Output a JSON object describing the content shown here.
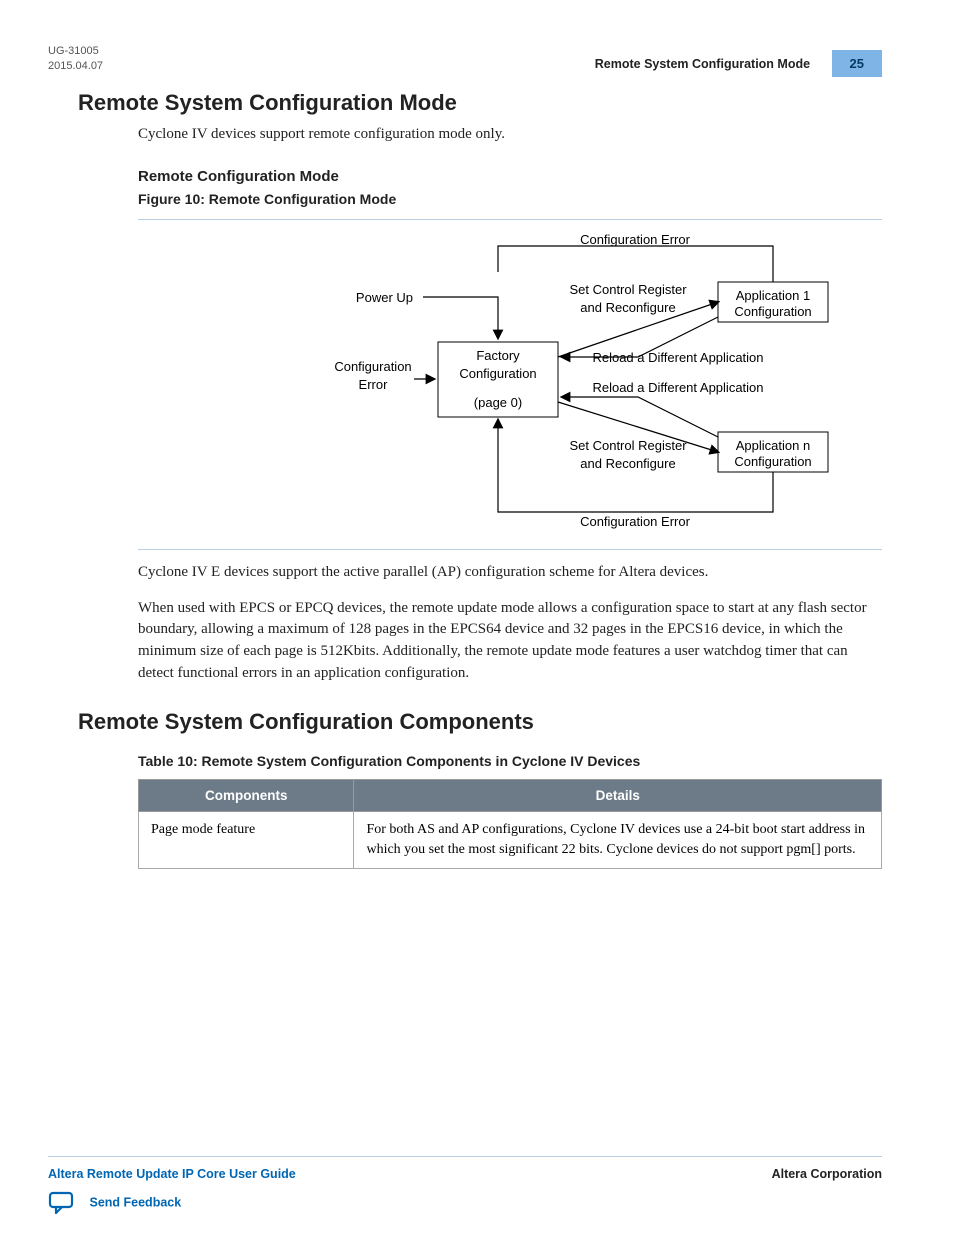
{
  "header": {
    "doc_id": "UG-31005",
    "date": "2015.04.07",
    "running_title": "Remote System Configuration Mode",
    "page_num": "25"
  },
  "s1": {
    "title": "Remote System Configuration Mode",
    "p1": "Cyclone IV devices support remote configuration mode only.",
    "sub1": "Remote Configuration Mode",
    "fig_caption": "Figure 10: Remote Configuration Mode"
  },
  "diagram": {
    "power_up": "Power Up",
    "config_error_left": "Configuration\nError",
    "factory_l1": "Factory",
    "factory_l2": "Configuration",
    "factory_l3": "(page 0)",
    "config_error_top": "Configuration Error",
    "set_ctrl_l1": "Set Control Register",
    "set_ctrl_l2": "and Reconfigure",
    "reload_app": "Reload a Different Application",
    "app1_l1": "Application 1",
    "app1_l2": "Configuration",
    "appn_l1": "Application n",
    "appn_l2": "Configuration",
    "config_error_bot": "Configuration Error"
  },
  "s1b": {
    "p2": "Cyclone IV E devices support the active parallel (AP) configuration scheme for Altera devices.",
    "p3": "When used with EPCS or EPCQ devices, the remote update mode allows a configuration space to start at any flash sector boundary, allowing a maximum of 128 pages in the EPCS64 device and 32 pages in the EPCS16 device, in which the minimum size of each page is 512Kbits. Additionally, the remote update mode features a user watchdog timer that can detect functional errors in an application configuration."
  },
  "s2": {
    "title": "Remote System Configuration Components",
    "table_caption": "Table 10: Remote System Configuration Components in Cyclone IV Devices",
    "col1": "Components",
    "col2": "Details",
    "row1_c1": "Page mode feature",
    "row1_c2": "For both AS and AP configurations, Cyclone IV devices use a 24-bit boot start address in which you set the most significant 22 bits. Cyclone devices do not support pgm[] ports."
  },
  "footer": {
    "guide": "Altera Remote Update IP Core User Guide",
    "corp": "Altera Corporation",
    "feedback": "Send Feedback"
  }
}
